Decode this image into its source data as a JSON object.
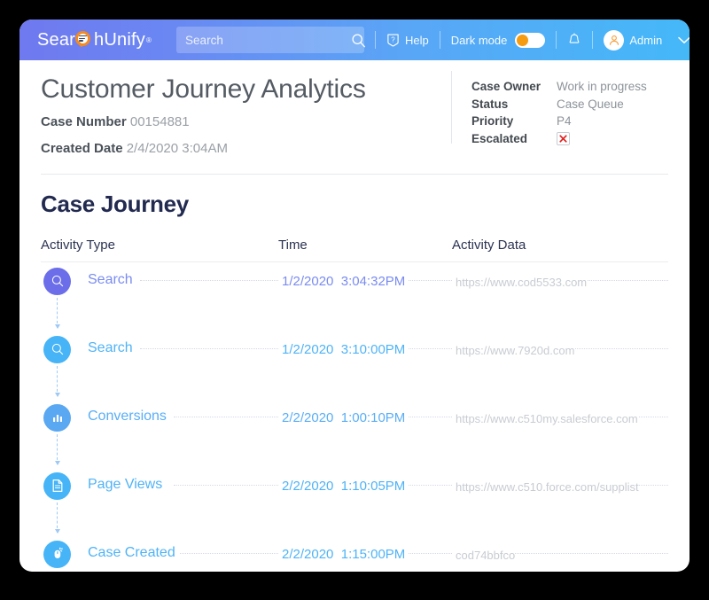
{
  "topbar": {
    "brand_part1": "Sear",
    "brand_part2": "hUnify",
    "brand_reg": "®",
    "search_placeholder": "Search",
    "search_value": "",
    "help_label": "Help",
    "dark_mode_label": "Dark mode",
    "dark_mode_on": false,
    "user_name": "Admin",
    "gradient_start": "#6f79f0",
    "gradient_end": "#45b8f8"
  },
  "header": {
    "title": "Customer Journey Analytics",
    "case_number_label": "Case Number",
    "case_number_value": "00154881",
    "created_date_label": "Created Date",
    "created_date_value": "2/4/2020 3:04AM"
  },
  "meta": {
    "rows": [
      {
        "label": "Case Owner",
        "value": "Work in progress"
      },
      {
        "label": "Status",
        "value": "Case Queue"
      },
      {
        "label": "Priority",
        "value": "P4"
      },
      {
        "label": "Escalated",
        "value": ""
      }
    ]
  },
  "journey": {
    "section_title": "Case Journey",
    "columns": {
      "activity_type": "Activity Type",
      "time": "Time",
      "activity_data": "Activity Data"
    },
    "rows": [
      {
        "icon": "search-icon",
        "label": "Search",
        "label_color": "#7a8cf0",
        "icon_bg": "#6b6ee8",
        "date": "1/2/2020",
        "time": "3:04:32PM",
        "time_color": "#7a8cf0",
        "data": "https://www.cod5533.com"
      },
      {
        "icon": "search-icon",
        "label": "Search",
        "label_color": "#4fb3f6",
        "icon_bg": "#46b4f7",
        "date": "1/2/2020",
        "time": "3:10:00PM",
        "time_color": "#4fb3f6",
        "data": "https://www.7920d.com"
      },
      {
        "icon": "bar-chart-icon",
        "label": "Conversions",
        "label_color": "#5aaef5",
        "icon_bg": "#5aa8f2",
        "date": "2/2/2020",
        "time": "1:00:10PM",
        "time_color": "#5aaef5",
        "data": "https://www.c510my.salesforce.com"
      },
      {
        "icon": "document-icon",
        "label": "Page Views",
        "label_color": "#4fb3f6",
        "icon_bg": "#46b4f7",
        "date": "2/2/2020",
        "time": "1:10:05PM",
        "time_color": "#4fb3f6",
        "data": "https://www.c510.force.com/supplist"
      },
      {
        "icon": "mouse-click-icon",
        "label": "Case Created",
        "label_color": "#4fb3f6",
        "icon_bg": "#46b4f7",
        "date": "2/2/2020",
        "time": "1:15:00PM",
        "time_color": "#4fb3f6",
        "data": "cod74bbfco"
      }
    ]
  }
}
